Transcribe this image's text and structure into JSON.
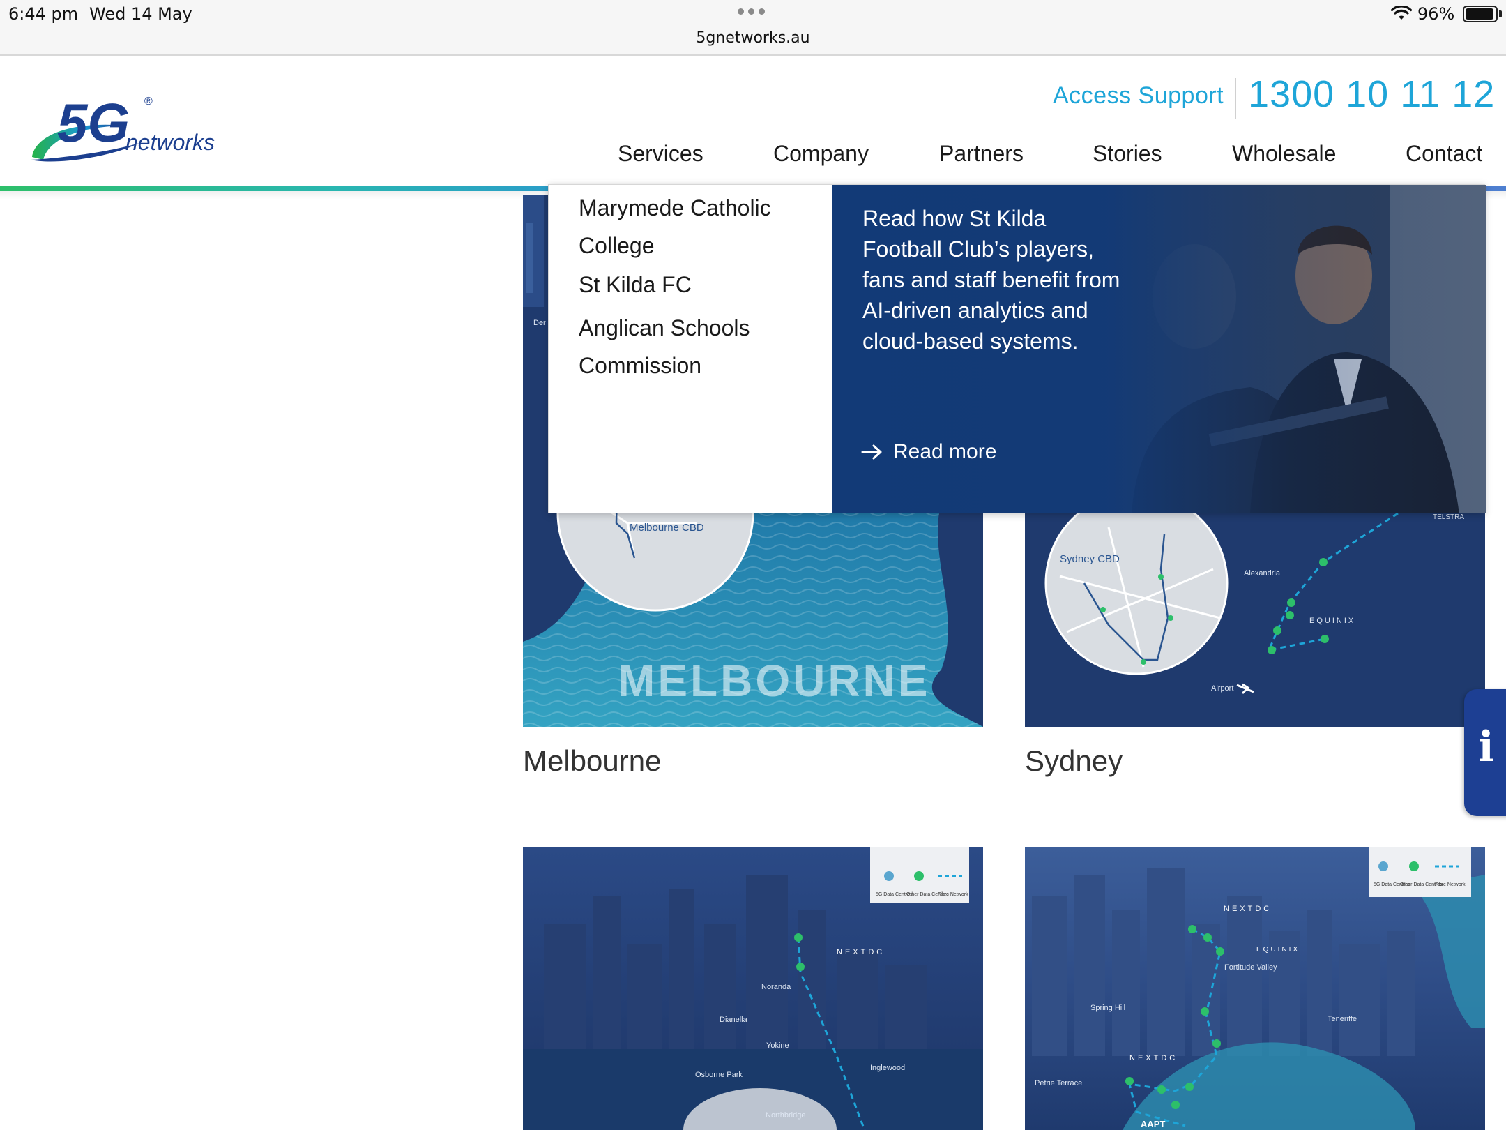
{
  "status_bar": {
    "time": "6:44 pm",
    "date": "Wed 14 May",
    "url": "5gnetworks.au",
    "battery_percent": "96%",
    "battery_level": 0.96
  },
  "header": {
    "logo_text_main": "5G",
    "logo_text_sub": "networks",
    "logo_registered": "®",
    "access_support": "Access Support",
    "phone": "1300 10 11 12",
    "nav": [
      "Services",
      "Company",
      "Partners",
      "Stories",
      "Wholesale",
      "Contact"
    ]
  },
  "dropdown": {
    "items": [
      "Marymede Catholic College",
      "St Kilda FC",
      "Anglican Schools Commission"
    ],
    "feature_text": "Read how St Kilda Football Club’s players, fans and staff benefit from AI-driven analytics and cloud-based systems.",
    "read_more": "Read more"
  },
  "cards": {
    "melbourne": {
      "label": "Melbourne",
      "map_title": "MELBOURNE",
      "inset_label": "Melbourne CBD",
      "edge_label": "Der"
    },
    "sydney": {
      "label": "Sydney",
      "inset_label": "Sydney CBD",
      "labels": [
        "Alexandria",
        "EQUINIX",
        "Airport",
        "TELSTRA"
      ]
    },
    "perth": {
      "legend": [
        "5G Data Centres",
        "Other Data Centres",
        "Fibre Network"
      ],
      "labels": [
        "NEXTDC",
        "Noranda",
        "Dianella",
        "Yokine",
        "Osborne Park",
        "Inglewood",
        "Northbridge"
      ]
    },
    "brisbane": {
      "legend": [
        "5G Data Centres",
        "Other Data Centres",
        "Fibre Network"
      ],
      "labels": [
        "NEXTDC",
        "EQUINIX",
        "Fortitude Valley",
        "Spring Hill",
        "Teneriffe",
        "NEXTDC",
        "Petrie Terrace",
        "AAPT"
      ]
    }
  },
  "info_tab": {
    "glyph": "i"
  },
  "colors": {
    "accent": "#1ea5d8",
    "navy": "#123a77",
    "card_navy": "#1f3a6e",
    "water": "#2d8fb0"
  }
}
